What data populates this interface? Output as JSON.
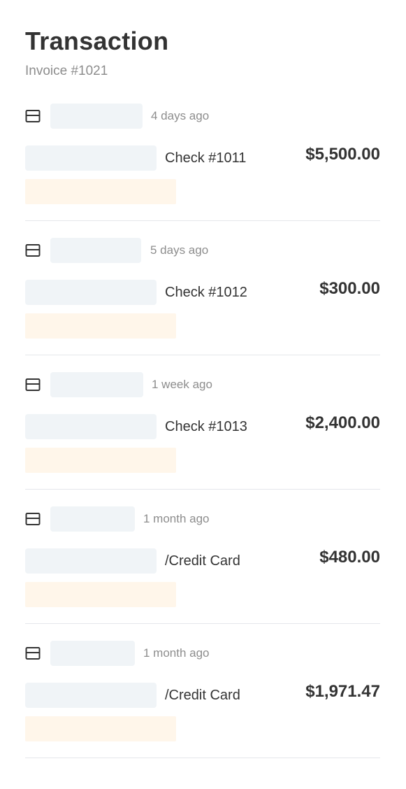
{
  "header": {
    "title": "Transaction",
    "subtitle": "Invoice #1021"
  },
  "transactions": [
    {
      "time": "4 days ago",
      "reference": "Check #1011",
      "amount": "$5,500.00",
      "icon": "card-icon"
    },
    {
      "time": "5 days ago",
      "reference": "Check #1012",
      "amount": "$300.00",
      "icon": "card-icon"
    },
    {
      "time": "1 week ago",
      "reference": "Check #1013",
      "amount": "$2,400.00",
      "icon": "card-icon"
    },
    {
      "time": "1 month ago",
      "reference": "/Credit Card",
      "amount": "$480.00",
      "icon": "card-icon"
    },
    {
      "time": "1 month ago",
      "reference": "/Credit Card",
      "amount": "$1,971.47",
      "icon": "card-icon"
    }
  ],
  "colors": {
    "text": "#333333",
    "muted": "#8d8d8d",
    "placeholder_gray": "#f0f4f7",
    "placeholder_cream": "#fff6ea",
    "divider": "#e5e7eb"
  }
}
